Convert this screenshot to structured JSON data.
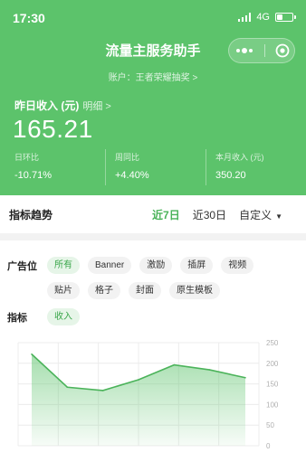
{
  "status_bar": {
    "time": "17:30",
    "network": "4G"
  },
  "app": {
    "title": "流量主服务助手",
    "account_line": "账户：王者荣耀抽奖 >"
  },
  "income": {
    "label": "昨日收入 (元)",
    "detail_link": "明细 >",
    "value": "165.21"
  },
  "stats": [
    {
      "label": "日环比",
      "value": "-10.71%"
    },
    {
      "label": "周同比",
      "value": "+4.40%"
    },
    {
      "label": "本月收入 (元)",
      "value": "350.20"
    }
  ],
  "trend": {
    "title": "指标趋势",
    "ranges": [
      "近7日",
      "近30日",
      "自定义"
    ],
    "active_range": 0
  },
  "filters": {
    "ad_slot_label": "广告位",
    "ad_slots": [
      "所有",
      "Banner",
      "激励",
      "插屏",
      "视频",
      "贴片",
      "格子",
      "封面",
      "原生模板"
    ],
    "ad_slot_active": 0,
    "metric_label": "指标",
    "metrics": [
      "收入"
    ],
    "metric_active": 0
  },
  "colors": {
    "brand_green": "#5cc36b",
    "line_green": "#4bb35a"
  },
  "icons": {
    "more": "more-dots-icon",
    "close": "target-close-icon",
    "dropdown": "caret-down-icon"
  },
  "chart_data": {
    "type": "area",
    "x": [
      1,
      2,
      3,
      4,
      5,
      6,
      7
    ],
    "values": [
      222,
      142,
      134,
      160,
      196,
      184,
      165
    ],
    "ylim": [
      0,
      250
    ],
    "yticks": [
      0,
      50,
      100,
      150,
      200,
      250
    ],
    "grid": true
  }
}
